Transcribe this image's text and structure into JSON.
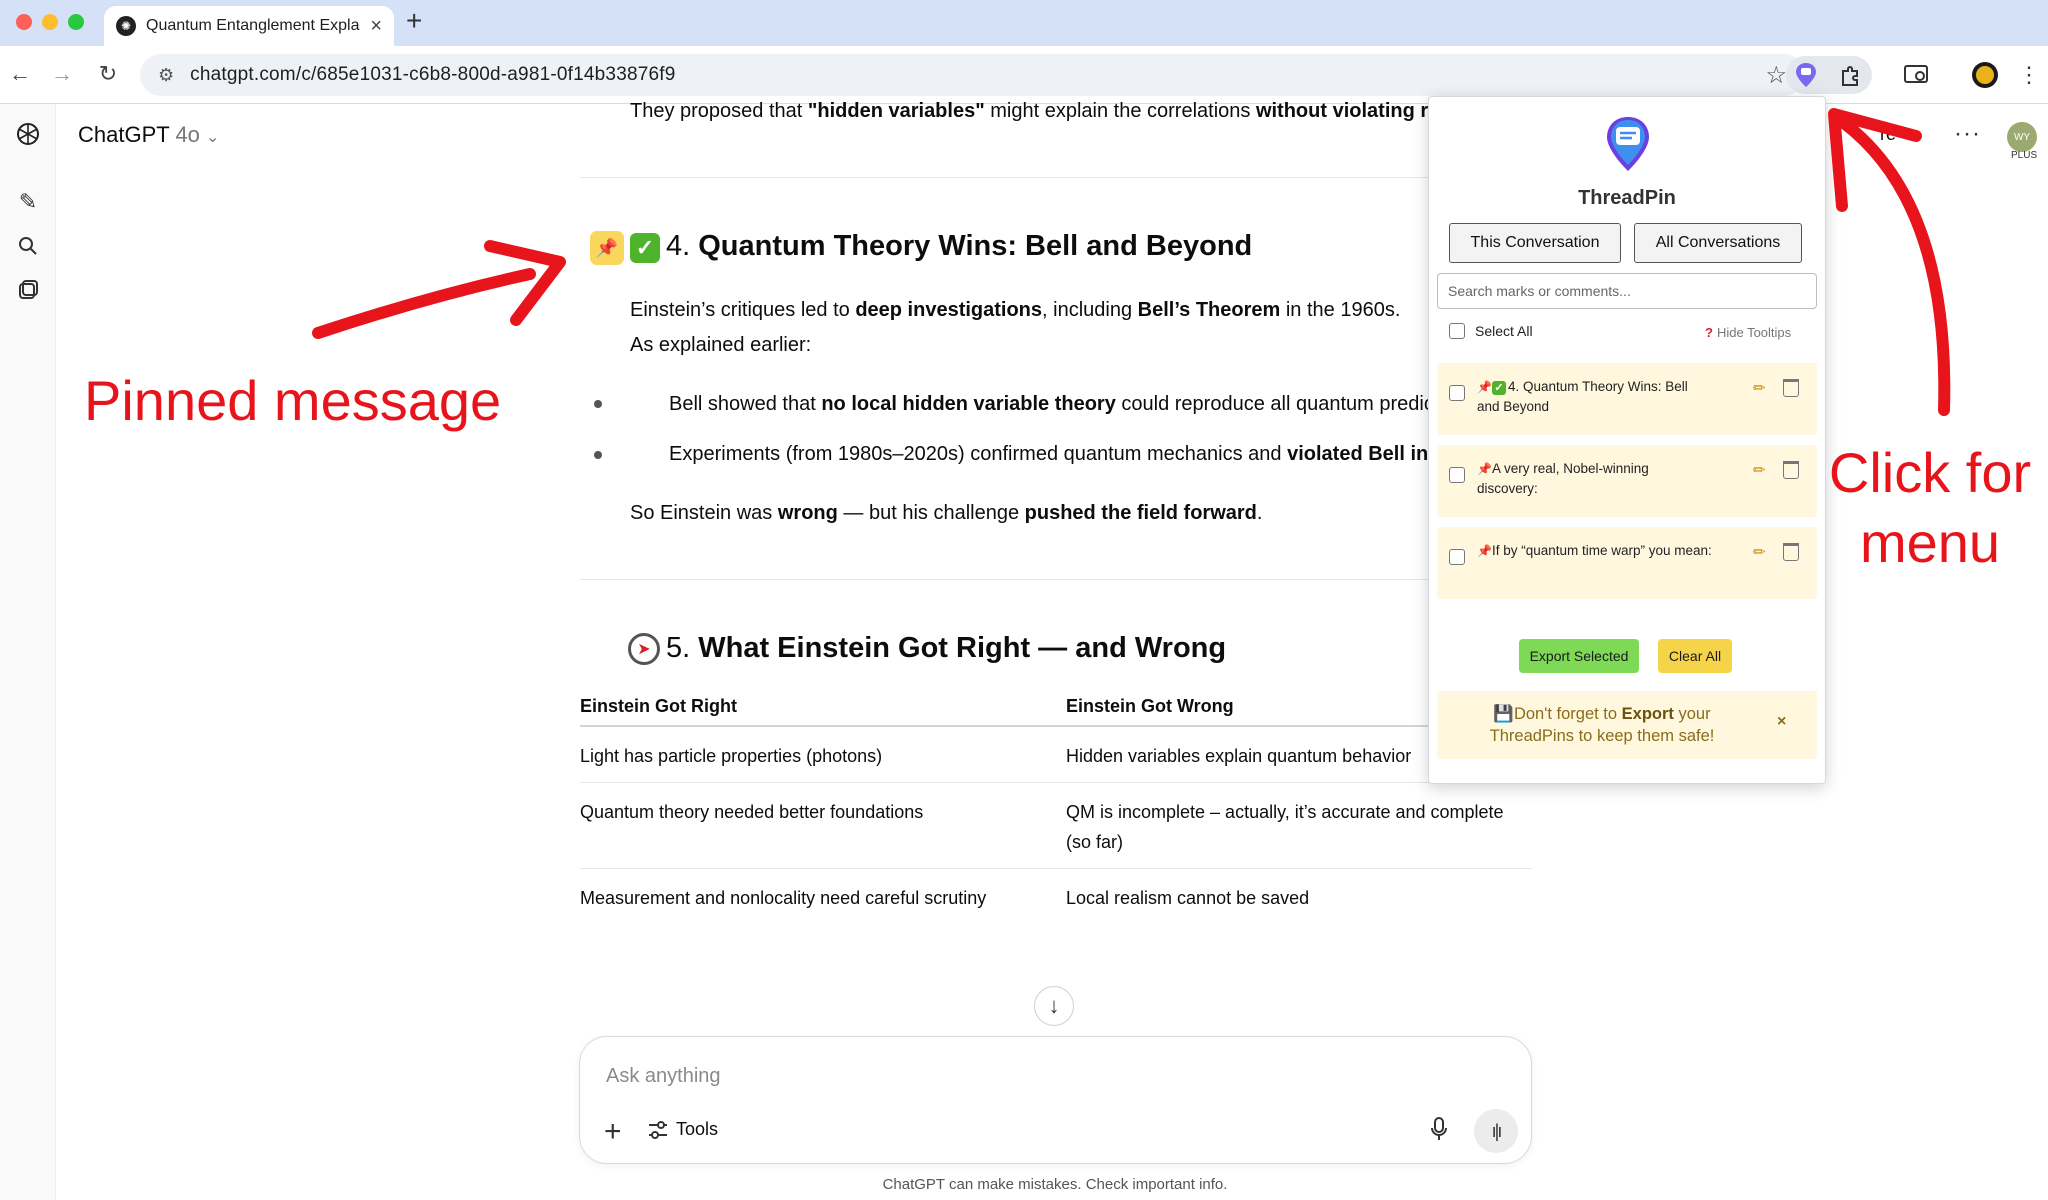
{
  "browser": {
    "tab_title": "Quantum Entanglement Expla",
    "tab_close": "×",
    "new_tab": "+",
    "url": "chatgpt.com/c/685e1031-c6b8-800d-a981-0f14b33876f9",
    "back": "←",
    "forward": "→",
    "reload": "↻",
    "star": "☆"
  },
  "chat_header": {
    "model_name": "ChatGPT",
    "model_version": "4o",
    "share_label": "re",
    "more_label": "···",
    "avatar_initials": "WY",
    "plan_badge": "PLUS"
  },
  "content": {
    "top_line": {
      "pre": "They proposed that ",
      "b1": "\"hidden variables\"",
      "mid": " might explain the correlations ",
      "b2": "without violating r"
    },
    "section4": {
      "number": "4. ",
      "title": "Quantum Theory Wins: Bell and Beyond",
      "p1_a": "Einstein’s critiques led to ",
      "p1_b": "deep investigations",
      "p1_c": ", including ",
      "p1_d": "Bell’s Theorem",
      "p1_e": " in the 1960s.",
      "p2": "As explained earlier:",
      "bullet1_a": "Bell showed that ",
      "bullet1_b": "no local hidden variable theory",
      "bullet1_c": " could reproduce all quantum predic",
      "bullet2_a": "Experiments (from 1980s–2020s) confirmed quantum mechanics and ",
      "bullet2_b": "violated Bell in",
      "summary_a": "So Einstein was ",
      "summary_b": "wrong",
      "summary_c": " — but his challenge ",
      "summary_d": "pushed the field forward",
      "summary_e": "."
    },
    "section5": {
      "number": "5. ",
      "title": "What Einstein Got Right — and Wrong",
      "table": {
        "headers": [
          "Einstein Got Right",
          "Einstein Got Wrong"
        ],
        "rows": [
          [
            "Light has particle properties (photons)",
            "Hidden variables explain quantum behavior"
          ],
          [
            "Quantum theory needed better foundations",
            "QM is incomplete – actually, it’s accurate and complete (so far)"
          ],
          [
            "Measurement and nonlocality need careful scrutiny",
            "Local realism cannot be saved"
          ]
        ]
      }
    }
  },
  "composer": {
    "placeholder": "Ask anything",
    "tools_label": "Tools",
    "disclaimer": "ChatGPT can make mistakes. Check important info."
  },
  "threadpin": {
    "title": "ThreadPin",
    "tab_this": "This Conversation",
    "tab_all": "All Conversations",
    "search_placeholder": "Search marks or comments...",
    "select_all": "Select All",
    "hide_tooltips": "Hide Tooltips",
    "items": [
      {
        "text": "4. Quantum Theory Wins: Bell and Beyond"
      },
      {
        "text": "A very real, Nobel-winning discovery:"
      },
      {
        "text": "If by “quantum time warp” you mean:"
      }
    ],
    "export_label": "Export Selected",
    "clear_label": "Clear All",
    "note_a": "Don't forget to ",
    "note_b": "Export",
    "note_c": " your ThreadPins to keep them safe!",
    "note_close": "×"
  },
  "annotations": {
    "pinned": "Pinned message",
    "click_line1": "Click for",
    "click_line2": "menu"
  },
  "colors": {
    "annotation_red": "#e8141b",
    "pin_badge": "#f8d75c",
    "export_green": "#7ed957",
    "clear_yellow": "#f6d44a",
    "item_bg": "#fff8de"
  }
}
